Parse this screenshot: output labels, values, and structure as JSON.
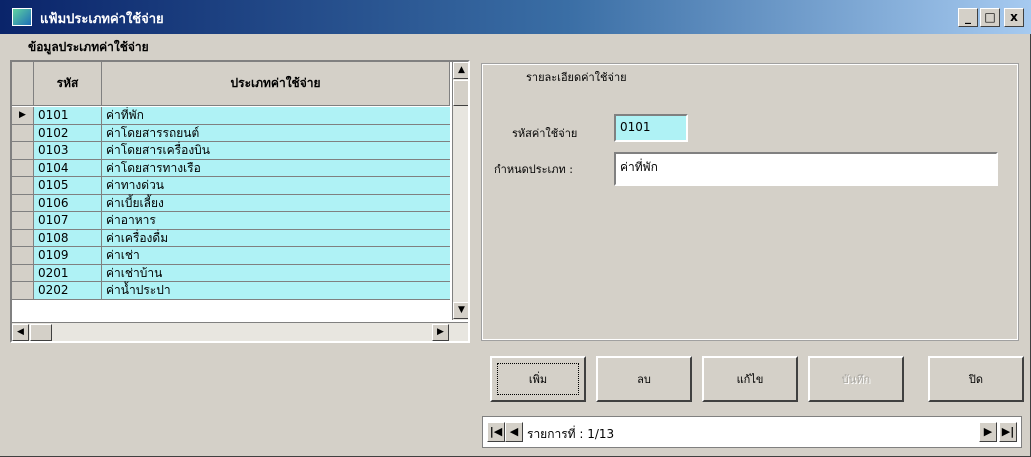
{
  "window": {
    "title": "แฟ้มประเภทค่าใช้จ่าย",
    "minimize_glyph": "_",
    "maximize_glyph": "□",
    "close_glyph": "x"
  },
  "section_title": "ข้อมูลประเภทค่าใช้จ่าย",
  "grid": {
    "headers": [
      "รหัส",
      "ประเภทค่าใช้จ่าย"
    ],
    "current_row_marker": "▶",
    "rows": [
      {
        "code": "0101",
        "name": "ค่าที่พัก"
      },
      {
        "code": "0102",
        "name": "ค่าโดยสารรถยนต์"
      },
      {
        "code": "0103",
        "name": "ค่าโดยสารเครื่องบิน"
      },
      {
        "code": "0104",
        "name": "ค่าโดยสารทางเรือ"
      },
      {
        "code": "0105",
        "name": "ค่าทางด่วน"
      },
      {
        "code": "0106",
        "name": "ค่าเบี้ยเลี้ยง"
      },
      {
        "code": "0107",
        "name": "ค่าอาหาร"
      },
      {
        "code": "0108",
        "name": "ค่าเครื่องดื่ม"
      },
      {
        "code": "0109",
        "name": "ค่าเช่า"
      },
      {
        "code": "0201",
        "name": "ค่าเช่าบ้าน"
      },
      {
        "code": "0202",
        "name": "ค่าน้ำประปา"
      }
    ],
    "scroll_up": "▲",
    "scroll_down": "▼",
    "scroll_left": "◀",
    "scroll_right": "▶"
  },
  "detail": {
    "legend": "รายละเอียดค่าใช้จ่าย",
    "code_label": "รหัสค่าใช้จ่าย",
    "code_value": "0101",
    "type_label": "กำหนดประเภท :",
    "type_value": "ค่าที่พัก"
  },
  "buttons": {
    "add": "เพิ่ม",
    "delete": "ลบ",
    "edit": "แก้ไข",
    "save": "บันทึก",
    "close": "ปิด"
  },
  "navigator": {
    "first": "|◀",
    "prev": "◀",
    "record_text": "รายการที่ : 1/13",
    "next": "▶",
    "last": "▶|"
  },
  "colors": {
    "row_bg": "#aff2f5",
    "titlebar_start": "#0a246a",
    "window_bg": "#d4d0c8"
  }
}
